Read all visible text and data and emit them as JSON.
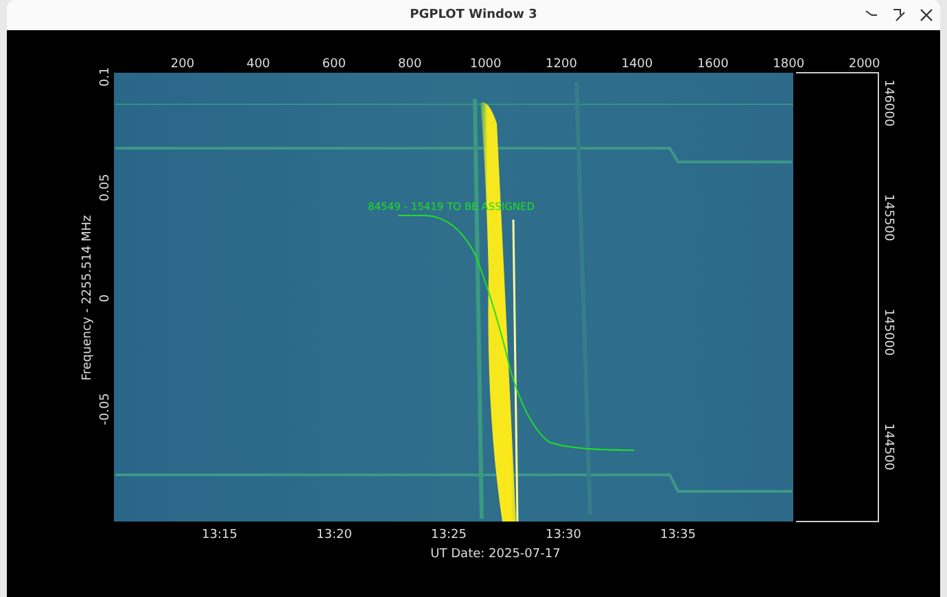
{
  "window": {
    "title": "PGPLOT Window 3"
  },
  "plot": {
    "top_axis": {
      "ticks": [
        "200",
        "400",
        "600",
        "800",
        "1000",
        "1200",
        "1400",
        "1600",
        "1800",
        "2000"
      ]
    },
    "left_axis": {
      "label": "Frequency - 2255.514 MHz",
      "ticks": [
        "0.1",
        "0.05",
        "0",
        "-0.05"
      ]
    },
    "right_axis": {
      "ticks": [
        "146000",
        "145500",
        "145000",
        "144500"
      ]
    },
    "bottom_axis": {
      "label": "UT Date: 2025-07-17",
      "ticks": [
        "13:15",
        "13:20",
        "13:25",
        "13:30",
        "13:35"
      ]
    },
    "annotation": "84549 - 15419 TO BE ASSIGNED"
  }
}
